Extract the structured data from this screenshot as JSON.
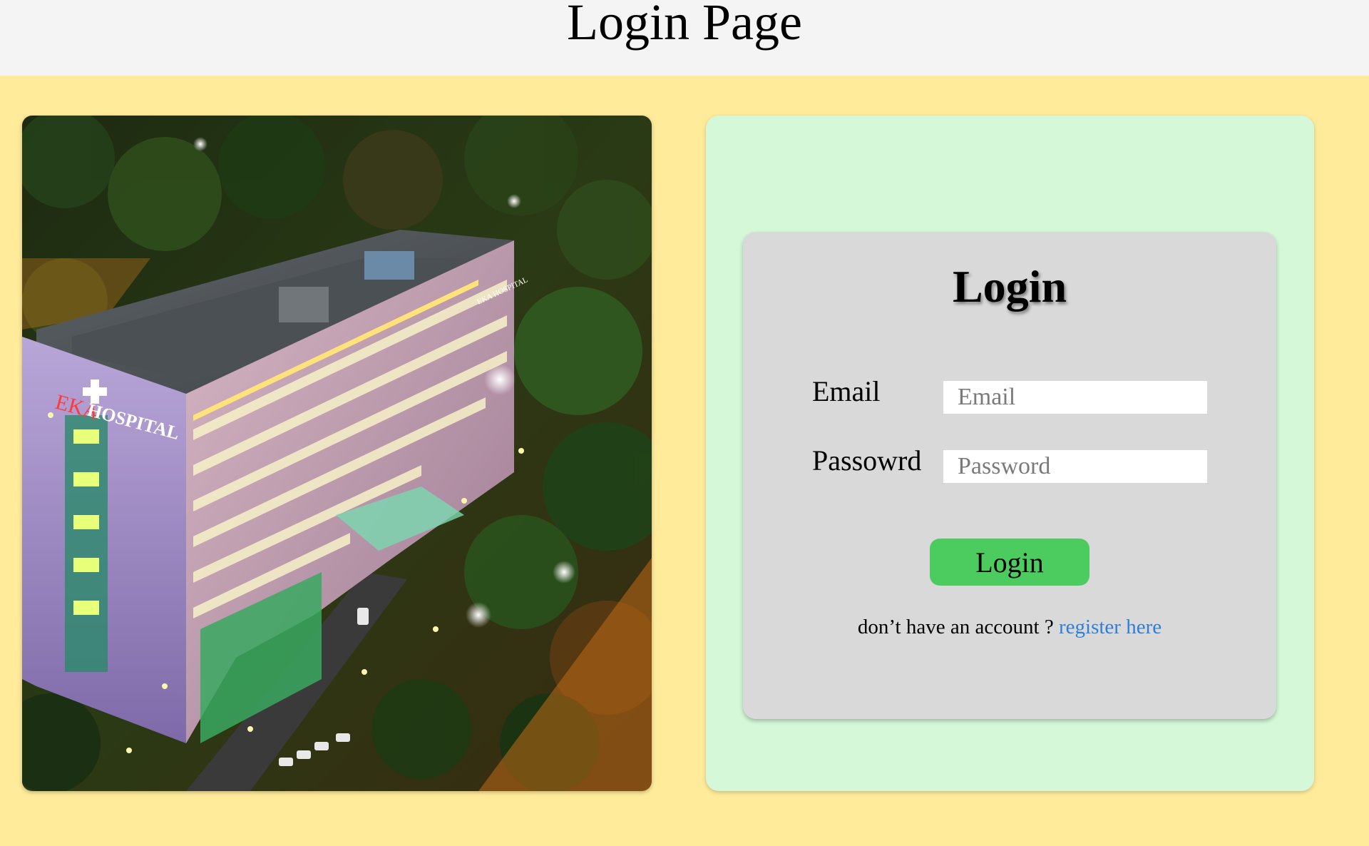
{
  "header": {
    "title": "Login Page"
  },
  "photo": {
    "sign_brand": "EKA",
    "sign_name": "HOSPITAL",
    "side_sign": "EKA HOSPITAL"
  },
  "login_card": {
    "title": "Login",
    "email_label": "Email",
    "email_placeholder": "Email",
    "password_label": "Passowrd",
    "password_placeholder": "Password",
    "submit_label": "Login",
    "register_prompt": "don’t have an account ?",
    "register_link": "register here"
  },
  "colors": {
    "page_background": "#ffeb9a",
    "header_background": "#f4f4f4",
    "panel_background": "#d4f8d8",
    "card_background": "#d9d9d9",
    "button_green": "#4ccb5e",
    "link_blue": "#2f7fd8"
  }
}
